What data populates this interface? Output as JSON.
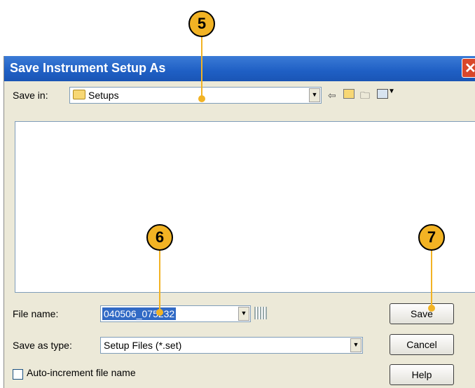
{
  "dialog": {
    "title": "Save Instrument Setup As",
    "save_in_label": "Save in:",
    "save_in_value": "Setups",
    "file_name_label": "File name:",
    "file_name_value": "040506_075232",
    "save_as_type_label": "Save as type:",
    "save_as_type_value": "Setup Files (*.set)",
    "auto_increment_label": "Auto-increment file name",
    "buttons": {
      "save": "Save",
      "cancel": "Cancel",
      "help": "Help"
    }
  },
  "callouts": [
    "5",
    "6",
    "7"
  ],
  "colors": {
    "callout": "#f2b324",
    "titlebar": "#1f5fc4",
    "selection": "#316ac5"
  }
}
